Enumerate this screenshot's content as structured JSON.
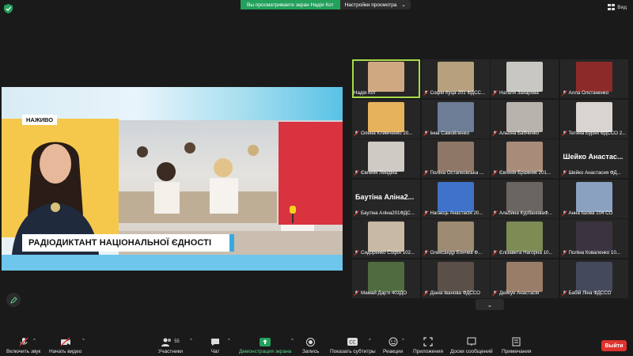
{
  "top": {
    "share_banner": "Вы просматриваете экран Надія Кот",
    "view_options": "Настройки просмотра",
    "view_label": "Вид"
  },
  "shared_screen": {
    "live_badge": "НАЖИВО",
    "title": "РАДІОДИКТАНТ НАЦІОНАЛЬНОЇ ЄДНОСТІ"
  },
  "gallery": {
    "tiles": [
      {
        "name": "Надія Кот",
        "muted": false,
        "active": true,
        "big": "",
        "color": "#cfa882"
      },
      {
        "name": "Софія Куца 201 ФДСС...",
        "muted": true,
        "active": false,
        "big": "",
        "color": "#b6a07e"
      },
      {
        "name": "Наталя Захарова",
        "muted": true,
        "active": false,
        "big": "",
        "color": "#c9c7c4"
      },
      {
        "name": "Алла Олєтаненко",
        "muted": true,
        "active": false,
        "big": "",
        "color": "#8c2a2a"
      },
      {
        "name": "Олена Климченко 20...",
        "muted": true,
        "active": false,
        "big": "",
        "color": "#e6b25c"
      },
      {
        "name": "Інна Самойленко",
        "muted": true,
        "active": false,
        "big": "",
        "color": "#6c7d95"
      },
      {
        "name": "Альона Бабченко",
        "muted": true,
        "active": false,
        "big": "",
        "color": "#b9b3ad"
      },
      {
        "name": "Тетяна Буряя ФДССО 2...",
        "muted": true,
        "active": false,
        "big": "",
        "color": "#d9d4cf"
      },
      {
        "name": "Євгенія Линдіна",
        "muted": true,
        "active": false,
        "big": "",
        "color": "#cfcac3"
      },
      {
        "name": "Поліна Остапковська ...",
        "muted": true,
        "active": false,
        "big": "",
        "color": "#8f7767"
      },
      {
        "name": "Євгенія Бражник 201...",
        "muted": true,
        "active": false,
        "big": "",
        "color": "#a88c79"
      },
      {
        "name": "Шейко Анастасия ФД...",
        "muted": true,
        "active": false,
        "big": "Шейко Анастас...",
        "color": ""
      },
      {
        "name": "Баутіна Аліна201ФДС...",
        "muted": true,
        "active": false,
        "big": "Баутіна Аліна2...",
        "color": ""
      },
      {
        "name": "Нагаєць Анастасія 20...",
        "muted": true,
        "active": false,
        "big": "",
        "color": "#3f72c8"
      },
      {
        "name": "Альбина КурбановаФ...",
        "muted": true,
        "active": false,
        "big": "",
        "color": "#6a6560"
      },
      {
        "name": "Анна Ішова 104 СО",
        "muted": true,
        "active": false,
        "big": "",
        "color": "#8aa1bf"
      },
      {
        "name": "Сидоренко Софія 102...",
        "muted": true,
        "active": false,
        "big": "",
        "color": "#c7b9a3"
      },
      {
        "name": "Олександр Бончев Ф...",
        "muted": true,
        "active": false,
        "big": "",
        "color": "#9c8a72"
      },
      {
        "name": "Єлізавета Нагорна 10...",
        "muted": true,
        "active": false,
        "big": "",
        "color": "#7d8b55"
      },
      {
        "name": "Поліна Коваленко 10...",
        "muted": true,
        "active": false,
        "big": "",
        "color": "#3a3440"
      },
      {
        "name": "Мамай Дар'я 403ДО",
        "muted": true,
        "active": false,
        "big": "",
        "color": "#4f6b3f"
      },
      {
        "name": "Діана Іванова ФДССО",
        "muted": true,
        "active": false,
        "big": "",
        "color": "#5b5049"
      },
      {
        "name": "Дейкун Анастасія",
        "muted": true,
        "active": false,
        "big": "",
        "color": "#9a7d68"
      },
      {
        "name": "Бабій Ліна ФДССО",
        "muted": true,
        "active": false,
        "big": "",
        "color": "#444a5c"
      }
    ]
  },
  "toolbar": {
    "unmute": "Включить звук",
    "video": "Начать видео",
    "participants": "Участники",
    "participants_count": "55",
    "chat": "Чат",
    "share": "Демонстрация экрана",
    "record": "Запись",
    "captions": "Показать субтитры",
    "reactions": "Реакции",
    "apps": "Приложения",
    "whiteboards": "Доски сообщений",
    "notes": "Примечания",
    "leave": "Выйти"
  },
  "colors": {
    "green_banner": "#23a05c",
    "active_speaker": "#a9d94b",
    "leave": "#e0322f"
  }
}
